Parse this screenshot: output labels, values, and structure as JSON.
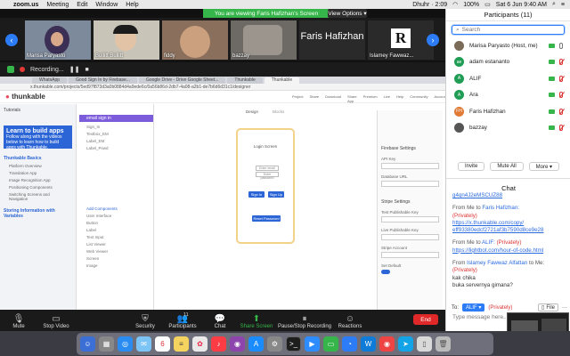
{
  "menubar": {
    "app": "zoom.us",
    "menus": [
      "Meeting",
      "Edit",
      "Window",
      "Help"
    ],
    "prayer": "Dhuhr · 2:09",
    "battery": "100%",
    "clock": "Sat 6 Jun 9:40 AM"
  },
  "screen_share": {
    "viewing_banner": "You are viewing Faris Hafizhan's Screen",
    "view_options": "View Options ▾"
  },
  "video_strip": {
    "tiles": [
      {
        "name": "Marisa Paryasto"
      },
      {
        "name": "Bullitt Bullitt"
      },
      {
        "name": "fiddy"
      },
      {
        "name": "bazzay"
      },
      {
        "name": "",
        "big": "Faris Hafizhan"
      },
      {
        "name": "Islamey Fawwaz...",
        "logo": "R"
      }
    ]
  },
  "recording": {
    "label": "Recording..."
  },
  "browser": {
    "tabs": [
      "WhatsApp",
      "Good Sign In by Firebase...",
      "Google Drive - Drive Google Sheet...",
      "Thunkable",
      "Thunkable"
    ],
    "url": "x.thunkable.com/projects/5ed97f873d3a0b0884d4a9ede6c/0a56b86d-2db7-4a08-a2b1-de7b6d6d31c1/designer",
    "brand": "thunkable",
    "toolbar_items": [
      "Project",
      "Share",
      "Download",
      "Share App",
      "Premium",
      "Live",
      "Help",
      "Community",
      "Account"
    ],
    "left_tabs": {
      "tutorials": "Tutorials"
    },
    "learn": {
      "title": "Learn to build apps",
      "desc": "Follow along with the videos below to learn how to build apps with Thunkable."
    },
    "basics_header": "Thunkable Basics",
    "basics_items": [
      "Platform Overview",
      "Translation App",
      "Image Recognition App",
      "Positioning Components",
      "Switching Screens and Navigation"
    ],
    "storing_header": "Storing Information with Variables",
    "screen_name": "email sign in",
    "components": [
      "Sign_In",
      "Textbox_EM",
      "Label_EM",
      "Label_Pswd"
    ],
    "components_bottom": [
      "Add Components",
      "User Interface",
      "Button",
      "Label",
      "Text Input",
      "List Viewer",
      "Web Viewer",
      "Screen",
      "Image"
    ],
    "canvas_tabs": [
      "Design",
      "Blocks"
    ],
    "phone": {
      "title": "Login Screen",
      "email": "Enter email",
      "password": "Enter password",
      "sign_in": "Sign In",
      "sign_up": "Sign Up",
      "reset": "Reset Password"
    },
    "right_panel": [
      "Firebase Settings",
      "API Key",
      "Database URL",
      "Stripe Settings",
      "Test Publishable Key",
      "Live Publishable Key",
      "Stripe Account",
      "Set Default"
    ]
  },
  "participants": {
    "header": "Participants (11)",
    "search_placeholder": "Search",
    "list": [
      {
        "name": "Marisa Paryasto (Host, me)",
        "initials": "",
        "color": "#7a6a58",
        "video": true,
        "mic": "on"
      },
      {
        "name": "adam estananto",
        "initials": "ae",
        "color": "#1f9d55",
        "video": true,
        "mic": "off"
      },
      {
        "name": "ALIF",
        "initials": "A",
        "color": "#1f9d55",
        "video": true,
        "mic": "off"
      },
      {
        "name": "Ara",
        "initials": "A",
        "color": "#1f9d55",
        "video": true,
        "mic": "off"
      },
      {
        "name": "Faris Hafizhan",
        "initials": "FH",
        "color": "#e07a35",
        "video": true,
        "mic": "off"
      },
      {
        "name": "bazzay",
        "initials": "",
        "color": "#555",
        "video": true,
        "mic": "off"
      }
    ],
    "buttons": {
      "invite": "Invite",
      "mute_all": "Mute All",
      "more": "More ▾"
    }
  },
  "chat": {
    "header": "Chat",
    "messages": [
      {
        "link": "g4qn4J2eMSCUZ88"
      },
      {
        "from": "From Me to",
        "to": "Faris Hafizhan:",
        "priv": "(Privately)",
        "links": [
          "https://x.thunkable.com/copy/",
          "eff93380edcf2721af3b7590d8ce9e28"
        ]
      },
      {
        "from": "From Me to",
        "to": "ALIF:",
        "priv": "(Privately)",
        "links": [
          "https://lightbot.com/hour-of-code.html"
        ]
      },
      {
        "from": "From",
        "sender": "Islamey Fawwaz Alfattan",
        "to": "to Me:",
        "priv": "(Privately)",
        "text": [
          "kak chika",
          "buka servernya gimana?"
        ]
      }
    ],
    "to_label": "To:",
    "to_value": "ALIF ▾",
    "to_priv": "(Privately)",
    "file_btn": "File",
    "input_placeholder": "Type message here..."
  },
  "zoom_toolbar": {
    "items": [
      "Mute",
      "Stop Video",
      "Security",
      "Participants",
      "Chat",
      "Share Screen",
      "Pause/Stop Recording",
      "Reactions"
    ],
    "participant_count": "11",
    "end": "End"
  },
  "colors": {
    "zoom_blue": "#2b7cf6",
    "zoom_green": "#35b54a",
    "end_red": "#e02828",
    "thunkable_purple": "#7d5cdb"
  }
}
